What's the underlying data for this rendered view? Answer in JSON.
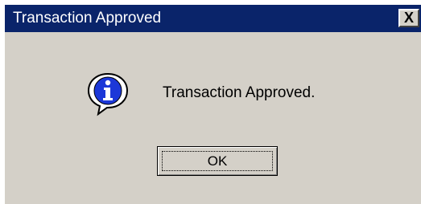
{
  "window": {
    "title": "Transaction Approved",
    "close_glyph": "X",
    "titlebar_color": "#0a246a",
    "background_color": "#d4d0c8"
  },
  "body": {
    "icon": "info-icon",
    "message": "Transaction Approved."
  },
  "buttons": {
    "ok_label": "OK"
  }
}
